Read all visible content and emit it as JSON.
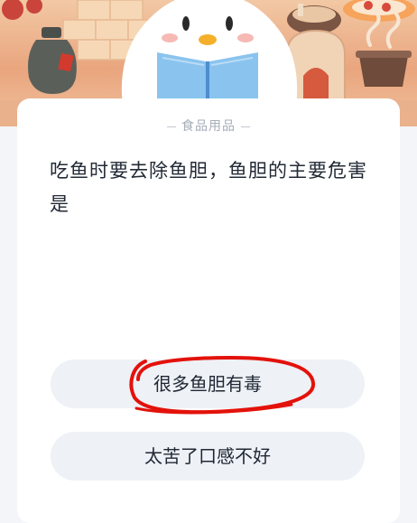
{
  "quiz": {
    "category": "食品用品",
    "question": "吃鱼时要去除鱼胆，鱼胆的主要危害是",
    "options": [
      {
        "label": "很多鱼胆有毒"
      },
      {
        "label": "太苦了口感不好"
      }
    ]
  },
  "colors": {
    "page_background": "#f3f5f9",
    "card_background": "#ffffff",
    "option_background": "#eef1f6",
    "annotation_stroke": "#e3120b"
  },
  "icons": {
    "mascot": "penguin-reading-book",
    "annotation": "hand-drawn-circle"
  }
}
